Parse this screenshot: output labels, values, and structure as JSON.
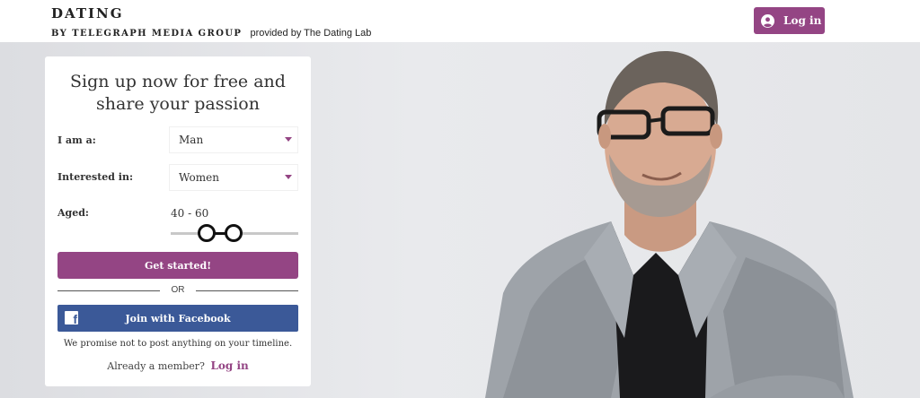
{
  "header": {
    "brand_title": "DATING",
    "brand_group": "BY TELEGRAPH MEDIA GROUP",
    "brand_provided": "provided by The Dating Lab",
    "login_label": "Log in"
  },
  "form": {
    "title": "Sign up now for free and share your passion",
    "iam_label": "I am a:",
    "iam_value": "Man",
    "interested_label": "Interested in:",
    "interested_value": "Women",
    "aged_label": "Aged:",
    "aged_value": "40 - 60",
    "age_range": {
      "min": 40,
      "max": 60
    },
    "cta_label": "Get started!",
    "or_label": "OR",
    "facebook_label": "Join with Facebook",
    "promise_text": "We promise not to post anything on your timeline.",
    "member_text": "Already a member?",
    "member_link": "Log in"
  },
  "colors": {
    "accent": "#944584",
    "facebook": "#3b5998",
    "background": "#e6e7ea"
  },
  "icons": {
    "login": "user-circle-icon",
    "facebook": "facebook-icon",
    "dropdown": "caret-down-icon"
  }
}
